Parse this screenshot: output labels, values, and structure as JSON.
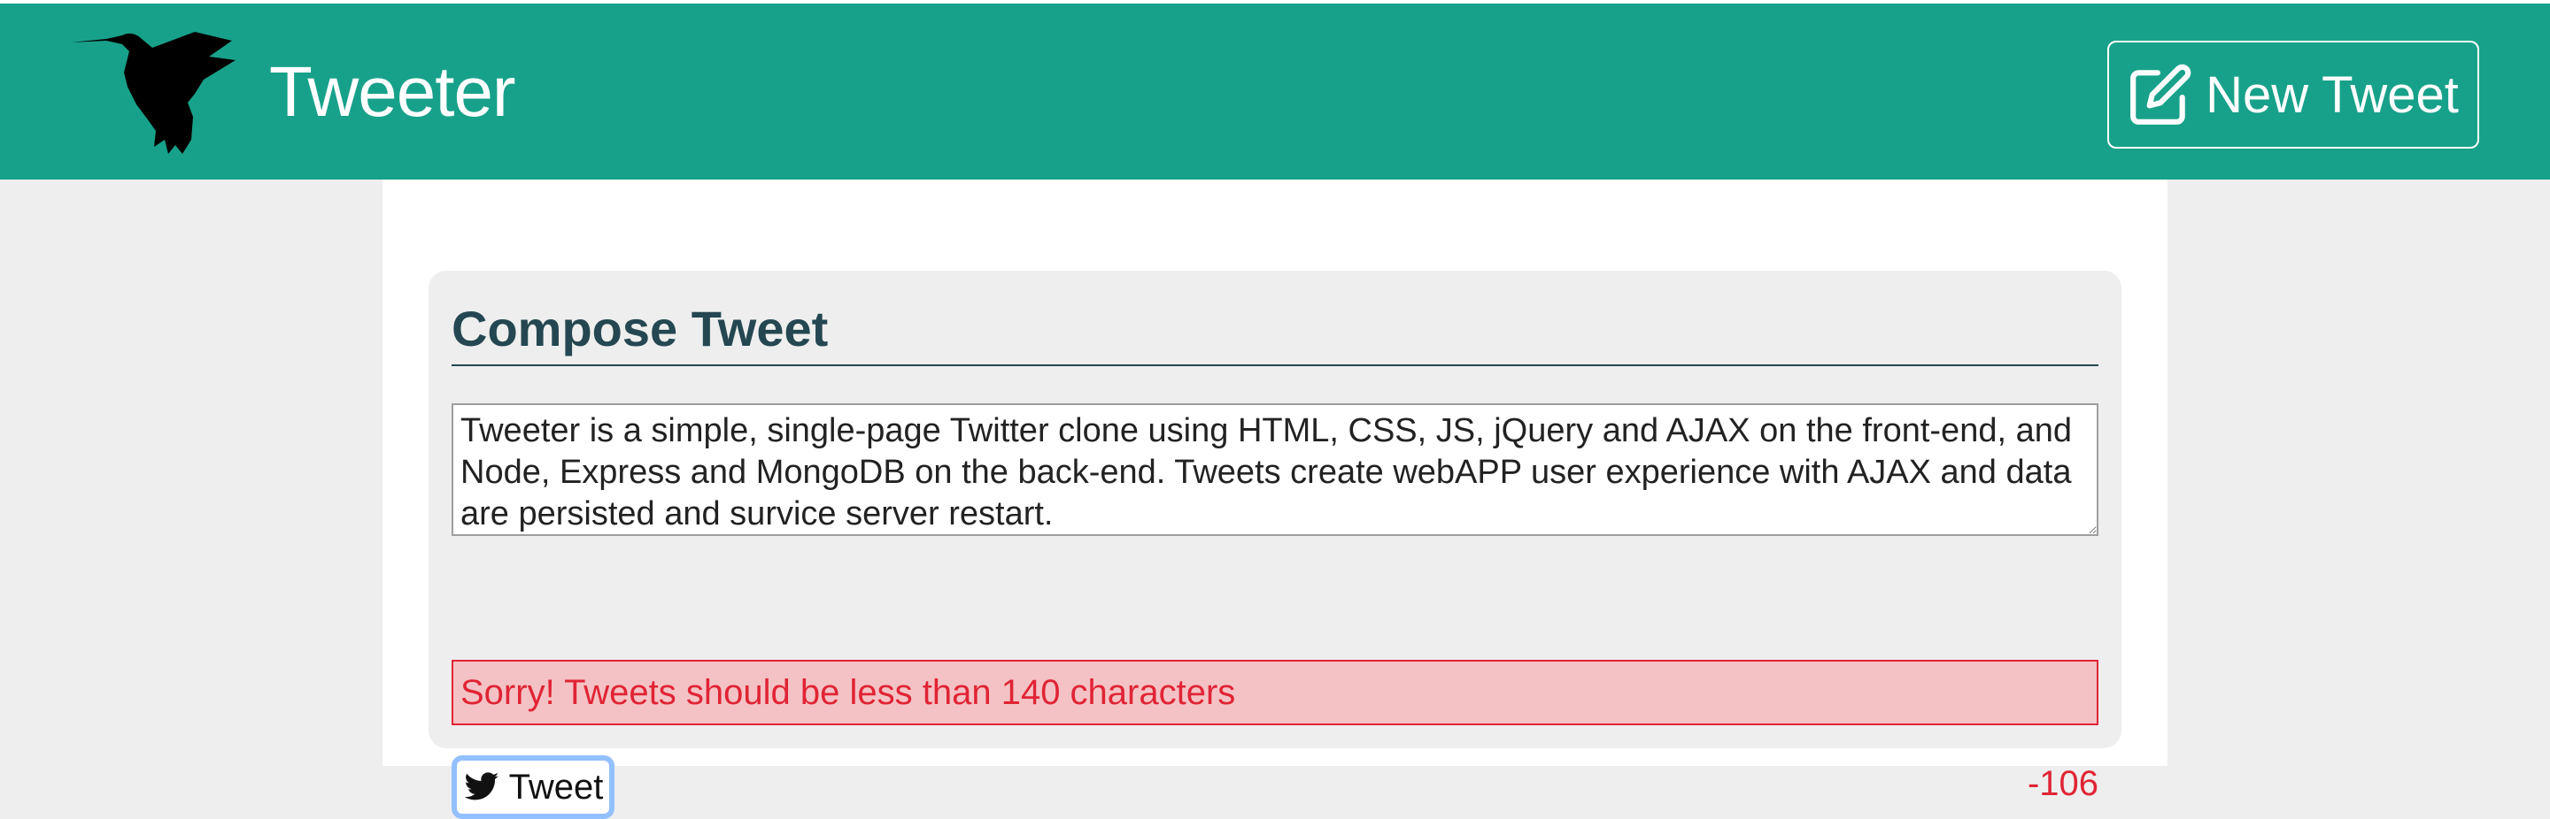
{
  "header": {
    "brand": "Tweeter",
    "new_tweet_label": "New Tweet",
    "bg_color": "#18a18a"
  },
  "compose": {
    "title": "Compose Tweet",
    "textarea_value": "Tweeter is a simple, single-page Twitter clone using HTML, CSS, JS, jQuery and AJAX on the front-end, and Node, Express and MongoDB on the back-end. Tweets create webAPP user experience with AJAX and data are persisted and survice server restart.",
    "error_message": "Sorry! Tweets should be less than 140 characters",
    "tweet_button_label": "Tweet",
    "char_counter": "-106",
    "error_color": "#e02434",
    "title_color": "#244751"
  },
  "icons": {
    "logo": "hummingbird-logo-icon",
    "new_tweet": "edit-icon",
    "tweet": "twitter-bird-icon"
  }
}
